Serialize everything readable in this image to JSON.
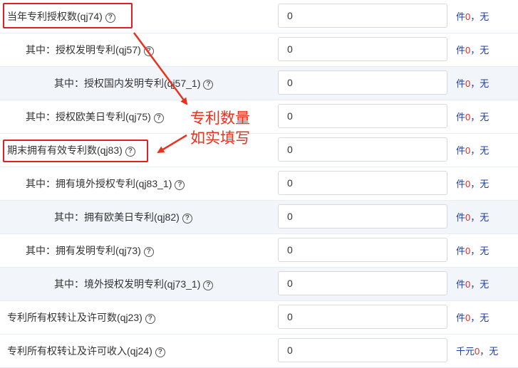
{
  "rows": [
    {
      "label": "当年专利授权数(qj74)",
      "value": "0",
      "unit": "件",
      "count": "0",
      "sep": "，无",
      "alt": false,
      "lvl": 0,
      "name": "row-qj74"
    },
    {
      "label": "其中：授权发明专利(qj57)",
      "value": "0",
      "unit": "件",
      "count": "0",
      "sep": "，无",
      "alt": false,
      "lvl": 1,
      "name": "row-qj57"
    },
    {
      "label": "其中：授权国内发明专利(qj57_1)",
      "value": "0",
      "unit": "件",
      "count": "0",
      "sep": "，无",
      "alt": true,
      "lvl": 2,
      "name": "row-qj57-1"
    },
    {
      "label": "其中：授权欧美日专利(qj75)",
      "value": "0",
      "unit": "件",
      "count": "0",
      "sep": "，无",
      "alt": false,
      "lvl": 1,
      "name": "row-qj75"
    },
    {
      "label": "期末拥有有效专利数(qj83)",
      "value": "0",
      "unit": "件",
      "count": "0",
      "sep": "，无",
      "alt": false,
      "lvl": 0,
      "name": "row-qj83"
    },
    {
      "label": "其中：拥有境外授权专利(qj83_1)",
      "value": "0",
      "unit": "件",
      "count": "0",
      "sep": "，无",
      "alt": false,
      "lvl": 1,
      "name": "row-qj83-1"
    },
    {
      "label": "其中：拥有欧美日专利(qj82)",
      "value": "0",
      "unit": "件",
      "count": "0",
      "sep": "，无",
      "alt": true,
      "lvl": 2,
      "name": "row-qj82"
    },
    {
      "label": "其中：拥有发明专利(qj73)",
      "value": "0",
      "unit": "件",
      "count": "0",
      "sep": "，无",
      "alt": false,
      "lvl": 1,
      "name": "row-qj73"
    },
    {
      "label": "其中：境外授权发明专利(qj73_1)",
      "value": "0",
      "unit": "件",
      "count": "0",
      "sep": "，无",
      "alt": true,
      "lvl": 2,
      "name": "row-qj73-1"
    },
    {
      "label": "专利所有权转让及许可数(qj23)",
      "value": "0",
      "unit": "件",
      "count": "0",
      "sep": "，无",
      "alt": false,
      "lvl": 0,
      "name": "row-qj23"
    },
    {
      "label": "专利所有权转让及许可收入(qj24)",
      "value": "0",
      "unit": "千元",
      "count": "0",
      "sep": "，无",
      "alt": false,
      "lvl": 0,
      "name": "row-qj24"
    }
  ],
  "help_icon": "question-circle-icon",
  "annotation": {
    "line1": "专利数量",
    "line2": "如实填写"
  },
  "colors": {
    "highlight": "#e02020",
    "annotation": "#e8321e",
    "unit": "#1f3fa3",
    "count": "#e0281b",
    "alt_row": "#f2f6fa"
  }
}
